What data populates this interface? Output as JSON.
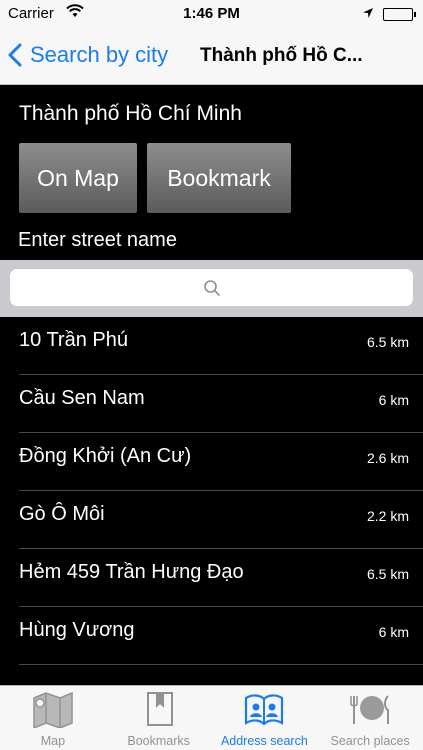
{
  "status_bar": {
    "carrier": "Carrier",
    "time": "1:46 PM"
  },
  "nav": {
    "back_label": "Search by city",
    "title": "Thành phố Hồ C..."
  },
  "header": {
    "city_name": "Thành phố Hồ Chí Minh",
    "on_map_label": "On Map",
    "bookmark_label": "Bookmark",
    "street_prompt": "Enter street name"
  },
  "search": {
    "placeholder": ""
  },
  "streets": [
    {
      "name": "10 Trần Phú",
      "distance": "6.5 km"
    },
    {
      "name": "Cầu Sen Nam",
      "distance": "6 km"
    },
    {
      "name": "Đồng Khởi (An Cư)",
      "distance": "2.6 km"
    },
    {
      "name": "Gò Ô Môi",
      "distance": "2.2 km"
    },
    {
      "name": "Hẻm 459 Trần Hưng Đạo",
      "distance": "6.5 km"
    },
    {
      "name": "Hùng Vương",
      "distance": "6 km"
    }
  ],
  "tabs": [
    {
      "label": "Map",
      "icon": "map-icon"
    },
    {
      "label": "Bookmarks",
      "icon": "bookmarks-icon"
    },
    {
      "label": "Address search",
      "icon": "address-book-icon",
      "active": true
    },
    {
      "label": "Search places",
      "icon": "plate-icon"
    }
  ],
  "colors": {
    "accent": "#1a7cf2",
    "list_bg": "#000000",
    "tab_inactive": "#929292"
  }
}
